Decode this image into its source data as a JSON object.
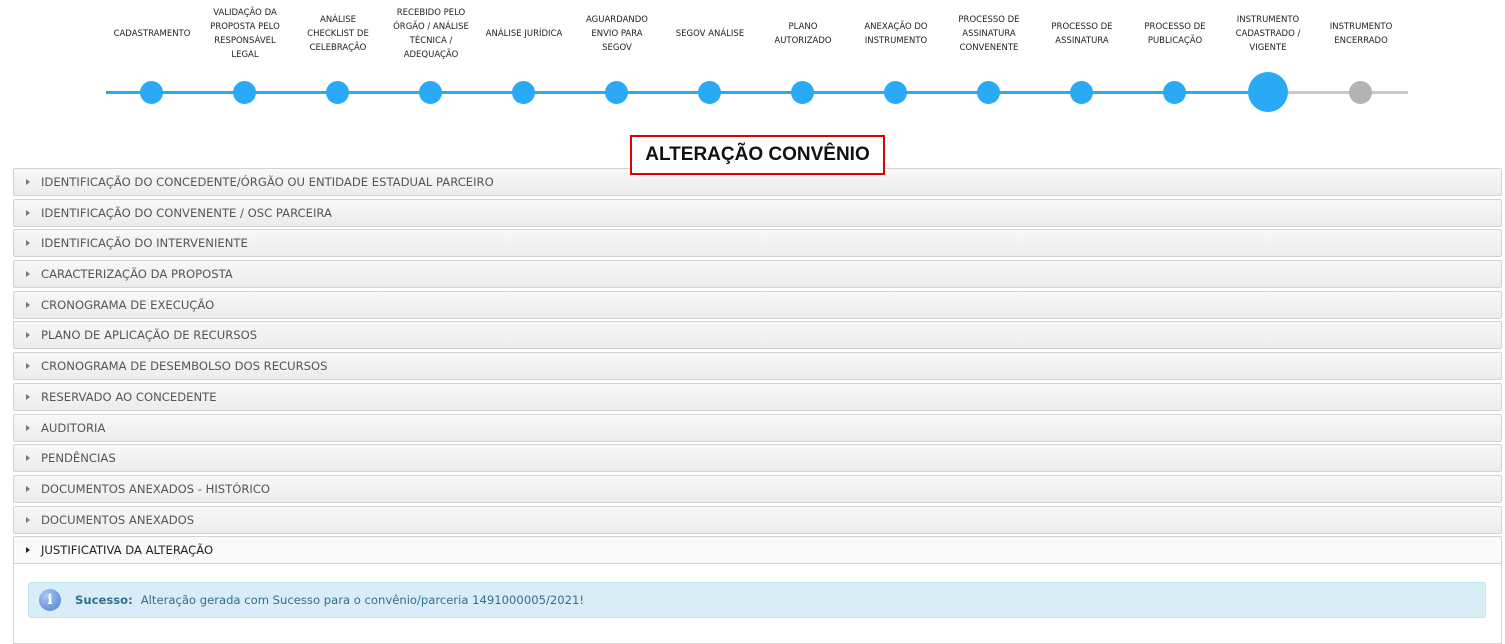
{
  "stepper": {
    "steps": [
      {
        "label": "CADASTRAMENTO",
        "status": "done"
      },
      {
        "label": "VALIDAÇÃO DA\nPROPOSTA PELO\nRESPONSÁVEL\nLEGAL",
        "status": "done"
      },
      {
        "label": "ANÁLISE\nCHECKLIST DE\nCELEBRAÇÃO",
        "status": "done"
      },
      {
        "label": "RECEBIDO PELO\nÓRGÃO / ANÁLISE\nTÉCNICA /\nADEQUAÇÃO",
        "status": "done"
      },
      {
        "label": "ANÁLISE JURÍDICA",
        "status": "done"
      },
      {
        "label": "AGUARDANDO\nENVIO PARA\nSEGOV",
        "status": "done"
      },
      {
        "label": "SEGOV ANÁLISE",
        "status": "done"
      },
      {
        "label": "PLANO\nAUTORIZADO",
        "status": "done"
      },
      {
        "label": "ANEXAÇÃO DO\nINSTRUMENTO",
        "status": "done"
      },
      {
        "label": "PROCESSO DE\nASSINATURA\nCONVENENTE",
        "status": "done"
      },
      {
        "label": "PROCESSO DE\nASSINATURA",
        "status": "done"
      },
      {
        "label": "PROCESSO DE\nPUBLICAÇÃO",
        "status": "done"
      },
      {
        "label": "INSTRUMENTO\nCADASTRADO /\nVIGENTE",
        "status": "current"
      },
      {
        "label": "INSTRUMENTO\nENCERRADO",
        "status": "pending"
      }
    ]
  },
  "page_title": "ALTERAÇÃO CONVÊNIO",
  "sections": [
    {
      "label": "IDENTIFICAÇÃO DO CONCEDENTE/ÓRGÃO OU ENTIDADE ESTADUAL PARCEIRO",
      "open": false
    },
    {
      "label": "IDENTIFICAÇÃO DO CONVENENTE / OSC PARCEIRA",
      "open": false
    },
    {
      "label": "IDENTIFICAÇÃO DO INTERVENIENTE",
      "open": false
    },
    {
      "label": "CARACTERIZAÇÃO DA PROPOSTA",
      "open": false
    },
    {
      "label": "CRONOGRAMA DE EXECUÇÃO",
      "open": false
    },
    {
      "label": "PLANO DE APLICAÇÃO DE RECURSOS",
      "open": false
    },
    {
      "label": "CRONOGRAMA DE DESEMBOLSO DOS RECURSOS",
      "open": false
    },
    {
      "label": "RESERVADO AO CONCEDENTE",
      "open": false
    },
    {
      "label": "AUDITORIA",
      "open": false
    },
    {
      "label": "PENDÊNCIAS",
      "open": false
    },
    {
      "label": "DOCUMENTOS ANEXADOS - HISTÓRICO",
      "open": false
    },
    {
      "label": "DOCUMENTOS ANEXADOS",
      "open": false
    },
    {
      "label": "JUSTIFICATIVA DA ALTERAÇÃO",
      "open": true
    }
  ],
  "alert": {
    "icon": "info-icon",
    "strong": "Sucesso:",
    "message": "Alteração gerada com Sucesso para o convênio/parceria 1491000005/2021!"
  },
  "colors": {
    "step_done": "#2aa9f5",
    "step_pending": "#b3b3b3",
    "title_border": "#dd0000",
    "alert_bg": "#d9edf7",
    "alert_text": "#31708f"
  }
}
